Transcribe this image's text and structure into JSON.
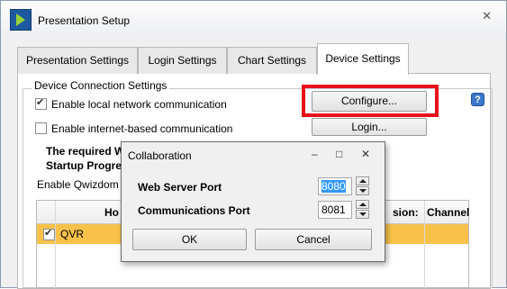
{
  "window": {
    "title": "Presentation Setup",
    "close_glyph": "✕"
  },
  "tabs": [
    {
      "label": "Presentation Settings"
    },
    {
      "label": "Login Settings"
    },
    {
      "label": "Chart Settings"
    },
    {
      "label": "Device Settings",
      "active": true
    }
  ],
  "group": {
    "title": "Device Connection Settings"
  },
  "options": {
    "local_network": {
      "label": "Enable local network communication",
      "checked": true
    },
    "internet": {
      "label": "Enable internet-based communication",
      "checked": false
    }
  },
  "buttons": {
    "configure": "Configure...",
    "login": "Login..."
  },
  "help": {
    "glyph": "?"
  },
  "notice": {
    "line1": "The required W",
    "line2": "Startup Progres"
  },
  "enable_text": "Enable Qwizdom F",
  "table": {
    "headers": {
      "host": "Ho",
      "version": "sion:",
      "channel": "Channel"
    },
    "rows": [
      {
        "checked": true,
        "name": "QVR"
      }
    ]
  },
  "dialog": {
    "title": "Collaboration",
    "controls": {
      "minimize": "–",
      "maximize": "□",
      "close": "✕"
    },
    "web_server_port": {
      "label": "Web Server Port",
      "value": "8080"
    },
    "communications_port": {
      "label": "Communications Port",
      "value": "8081"
    },
    "ok": "OK",
    "cancel": "Cancel"
  },
  "colors": {
    "highlight_row": "#f8c24a",
    "annotation": "#e8101a"
  }
}
